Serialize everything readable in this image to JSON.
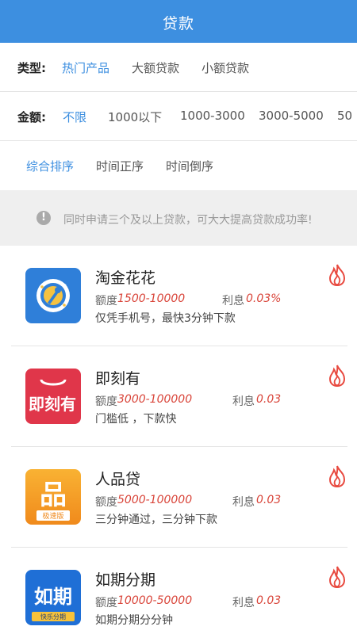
{
  "header": {
    "title": "贷款"
  },
  "filters": {
    "type": {
      "label": "类型:",
      "options": [
        "热门产品",
        "大额贷款",
        "小额贷款"
      ],
      "active_index": 0
    },
    "amount": {
      "label": "金额:",
      "options": [
        "不限",
        "1000以下",
        "1000-3000",
        "3000-5000",
        "50"
      ],
      "active_index": 0
    }
  },
  "sort": {
    "options": [
      "综合排序",
      "时间正序",
      "时间倒序"
    ],
    "active_index": 0
  },
  "notice": {
    "icon": "exclamation-icon",
    "text": "同时申请三个及以上贷款，可大大提高贷款成功率!"
  },
  "products": [
    {
      "name": "淘金花花",
      "quota_label": "额度",
      "quota": "1500-10000",
      "rate_label": "利息",
      "rate": "0.03%",
      "desc": "仅凭手机号，最快3分钟下款",
      "logo": "taojin-logo"
    },
    {
      "name": "即刻有",
      "quota_label": "额度",
      "quota": "3000-100000",
      "rate_label": "利息",
      "rate": "0.03",
      "desc": "门槛低 ，下款快",
      "logo": "jikeyou-logo",
      "logo_text": "即刻有"
    },
    {
      "name": "人品贷",
      "quota_label": "额度",
      "quota": "5000-100000",
      "rate_label": "利息",
      "rate": "0.03",
      "desc": "三分钟通过，三分钟下款",
      "logo": "renpindai-logo",
      "logo_text": "品",
      "logo_sub": "极速版"
    },
    {
      "name": "如期分期",
      "quota_label": "额度",
      "quota": "10000-50000",
      "rate_label": "利息",
      "rate": "0.03",
      "desc": "如期分期分分钟",
      "logo": "ruqi-logo",
      "logo_text": "如期",
      "logo_sub": "快乐分期"
    }
  ],
  "colors": {
    "accent": "#3d8fe0",
    "value_red": "#d9453a",
    "fire": "#e8493f"
  }
}
